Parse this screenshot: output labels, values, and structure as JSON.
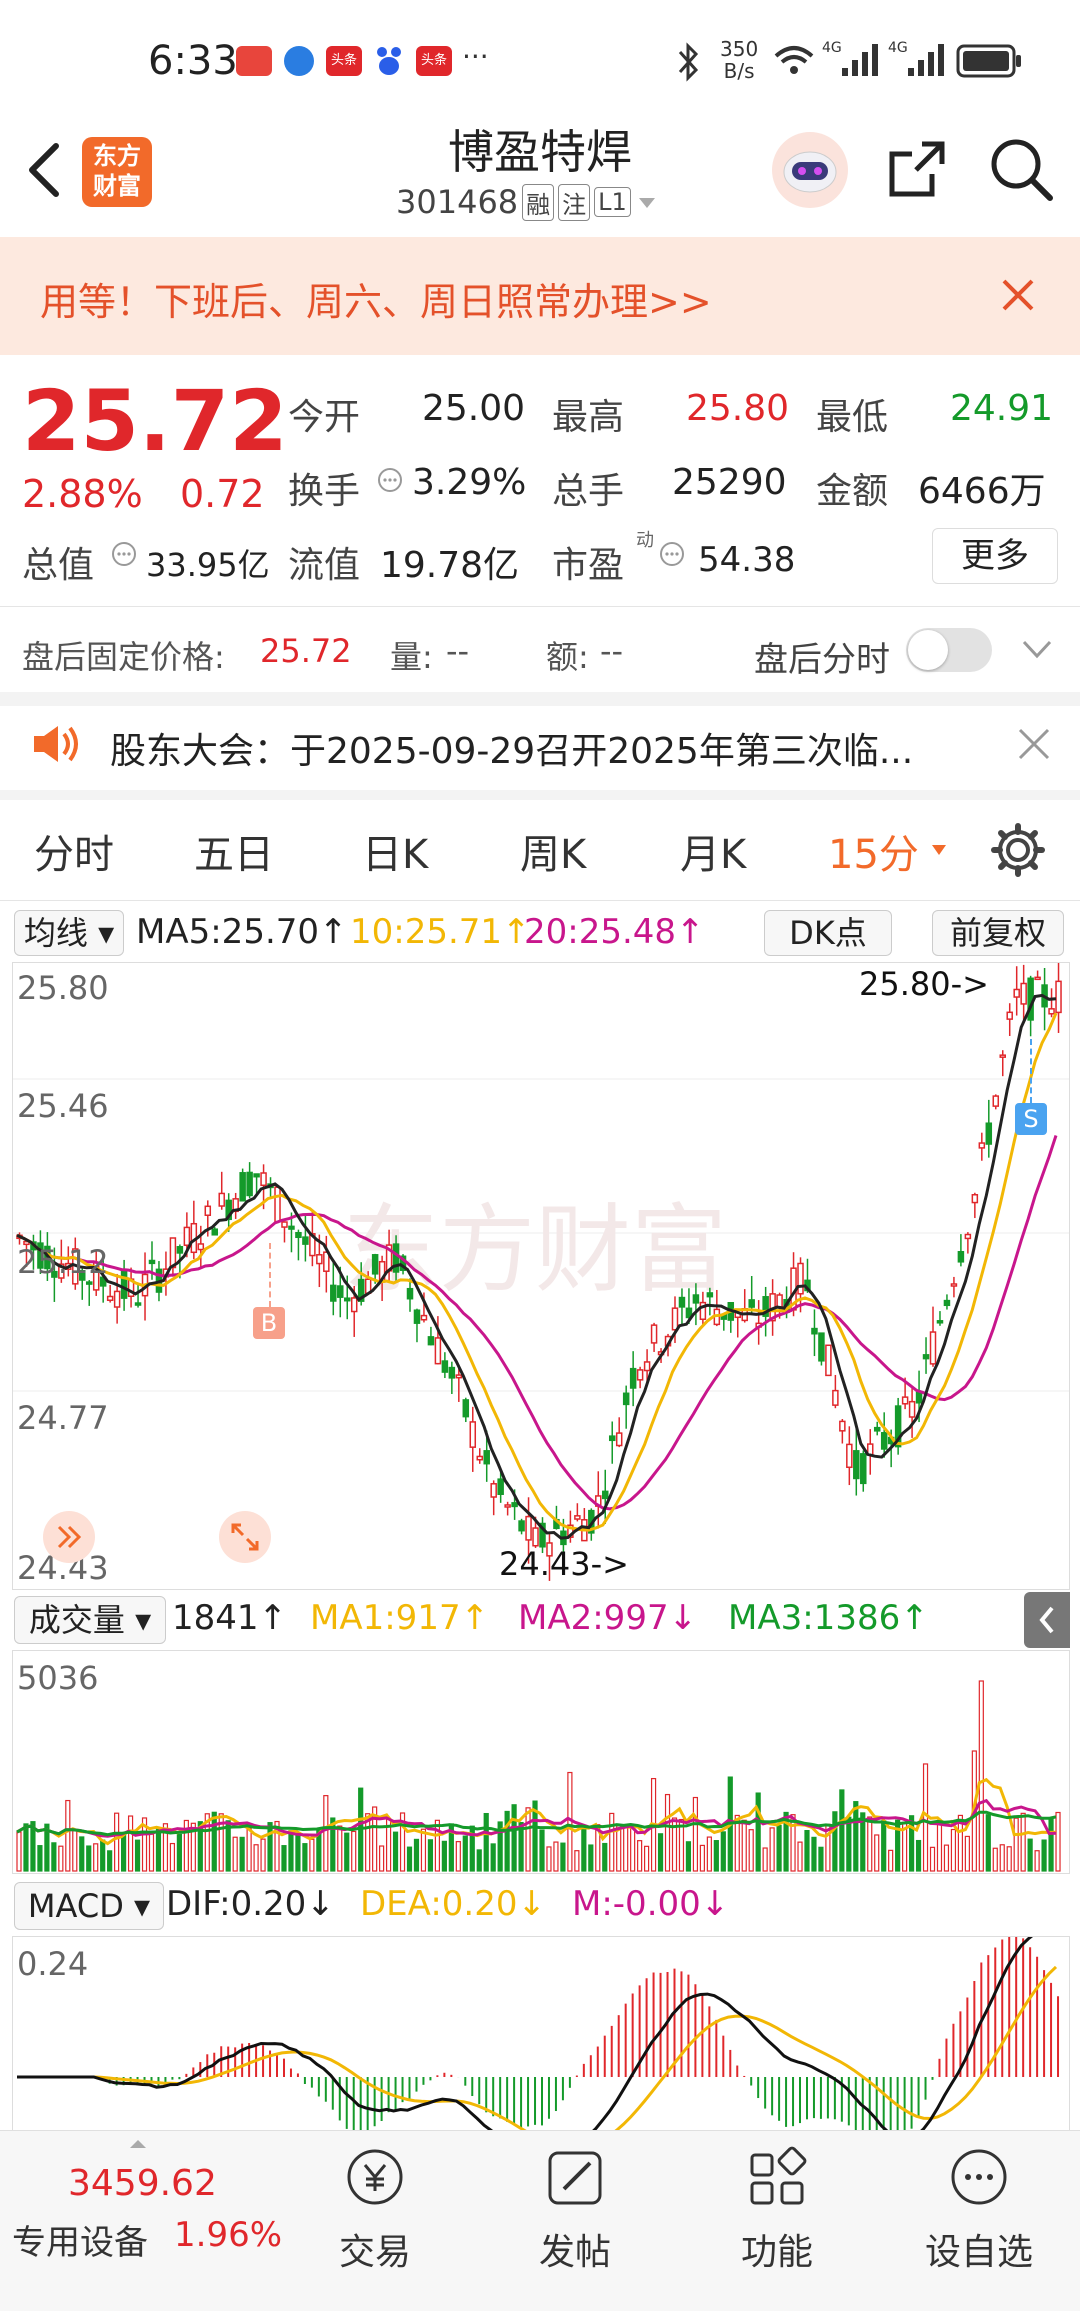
{
  "status_bar": {
    "time": "6:33",
    "net_speed_top": "350",
    "net_speed_bottom": "B/s",
    "badge_1": "头条",
    "badge_2": "头条",
    "more": "···",
    "sig1": "4G",
    "sig2": "4G"
  },
  "header": {
    "logo_line1": "东方",
    "logo_line2": "财富",
    "stock_name": "博盈特焊",
    "stock_code": "301468",
    "tag_margin": "融",
    "tag_watch": "注",
    "tag_level": "L1"
  },
  "notice": {
    "text": "用等！下班后、周六、周日照常办理>>"
  },
  "quote": {
    "price": "25.72",
    "change_pct": "2.88%",
    "change_amt": "0.72",
    "open_label": "今开",
    "open": "25.00",
    "high_label": "最高",
    "high": "25.80",
    "low_label": "最低",
    "low": "24.91",
    "turnover_label": "换手",
    "turnover": "3.29%",
    "volume_label": "总手",
    "volume": "25290",
    "amount_label": "金额",
    "amount": "6466万",
    "mcap_label": "总值",
    "mcap": "33.95亿",
    "float_label": "流值",
    "float_cap": "19.78亿",
    "pe_label": "市盈",
    "pe_sup": "动",
    "pe": "54.38",
    "more_button": "更多"
  },
  "after_hours": {
    "price_label": "盘后固定价格:",
    "price": "25.72",
    "vol_label": "量:",
    "vol": "--",
    "amt_label": "额:",
    "amt": "--",
    "toggle_label": "盘后分时"
  },
  "announcement": {
    "text": "股东大会：于2025-09-29召开2025年第三次临..."
  },
  "tabs": [
    "分时",
    "五日",
    "日K",
    "周K",
    "月K",
    "15分"
  ],
  "active_tab": "15分",
  "kline": {
    "indicator_btn": "均线",
    "ma5": "MA5:25.70↑",
    "ma10": "10:25.71↑",
    "ma20": "20:25.48↑",
    "dk_btn": "DK点",
    "fq_btn": "前复权",
    "y_labels": [
      "25.80",
      "25.46",
      "25.12",
      "24.77",
      "24.43"
    ],
    "max_annot": "25.80->",
    "min_annot": "24.43->",
    "buy_mark": "B",
    "sell_mark": "S",
    "watermark": "东方财富"
  },
  "volume": {
    "btn": "成交量",
    "cur": "1841↑",
    "ma1": "MA1:917↑",
    "ma2": "MA2:997↓",
    "ma3": "MA3:1386↑",
    "y_top": "5036"
  },
  "macd": {
    "btn": "MACD",
    "dif": "DIF:0.20↓",
    "dea": "DEA:0.20↓",
    "m": "M:-0.00↓",
    "y_top": "0.24"
  },
  "colors": {
    "up": "#e0272b",
    "down": "#149a2a",
    "accent": "#f26a2a",
    "ma10": "#f2b705",
    "ma20": "#c8168c"
  },
  "bottom_nav": {
    "index_value": "3459.62",
    "index_name": "专用设备",
    "index_pct": "1.96%",
    "items": [
      "交易",
      "发帖",
      "功能",
      "设自选"
    ]
  }
}
